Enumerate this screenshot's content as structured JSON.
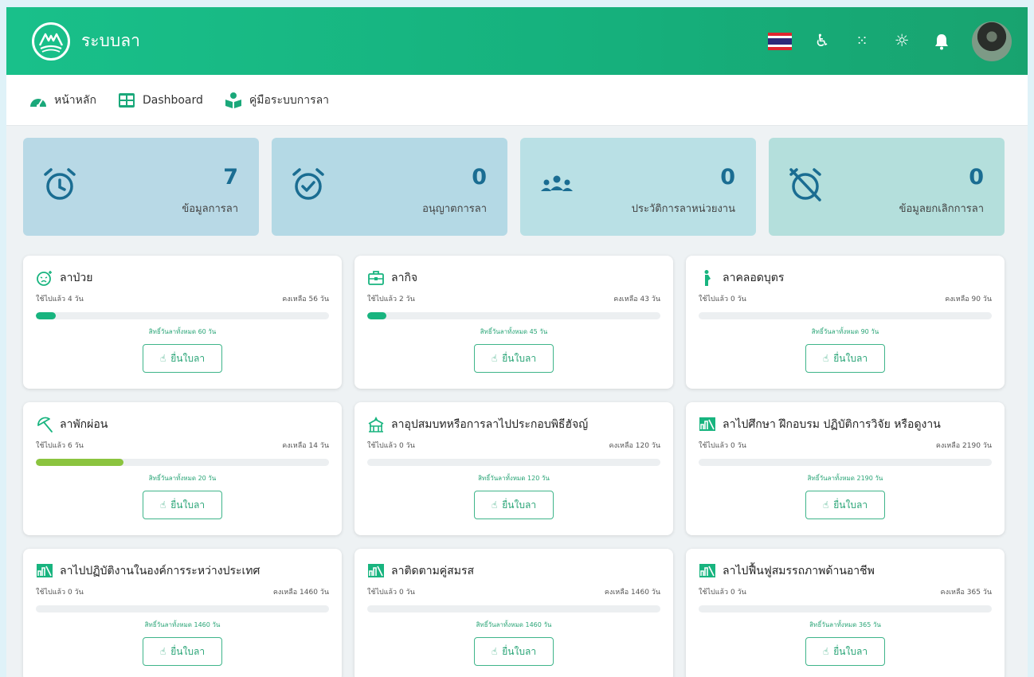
{
  "app": {
    "title": "ระบบลา"
  },
  "topbar": {
    "icons": [
      "thai-flag-icon",
      "accessibility-icon",
      "sign-language-icon",
      "theme-sun-icon",
      "bell-icon",
      "user-avatar"
    ],
    "brand_color": "#19c08a"
  },
  "nav": {
    "items": [
      {
        "label": "หน้าหลัก",
        "icon": "dashboard-gauge-icon"
      },
      {
        "label": "Dashboard",
        "icon": "grid-table-icon"
      },
      {
        "label": "คู่มือระบบการลา",
        "icon": "manual-book-icon"
      }
    ]
  },
  "stats": [
    {
      "value": "7",
      "label": "ข้อมูลการลา",
      "icon": "alarm-clock-icon",
      "color": "#b8d9e6"
    },
    {
      "value": "0",
      "label": "อนุญาตการลา",
      "icon": "alarm-check-icon",
      "color": "#b4d9e5"
    },
    {
      "value": "0",
      "label": "ประวัติการลาหน่วยงาน",
      "icon": "people-group-icon",
      "color": "#b9e0e5"
    },
    {
      "value": "0",
      "label": "ข้อมูลยกเลิกการลา",
      "icon": "alarm-off-icon",
      "color": "#b4dfdc"
    }
  ],
  "leave_types": [
    {
      "title": "ลาป่วย",
      "icon": "sick-face-icon",
      "used": "ใช้ไปแล้ว 4 วัน",
      "remaining": "คงเหลือ 56 วัน",
      "total": "สิทธิ์วันลาทั้งหมด 60 วัน",
      "progress": 0.067,
      "bar_color": "#18b47f",
      "button": "ยื่นใบลา"
    },
    {
      "title": "ลากิจ",
      "icon": "briefcase-icon",
      "used": "ใช้ไปแล้ว 2 วัน",
      "remaining": "คงเหลือ 43 วัน",
      "total": "สิทธิ์วันลาทั้งหมด 45 วัน",
      "progress": 0.044,
      "bar_color": "#18b47f",
      "button": "ยื่นใบลา"
    },
    {
      "title": "ลาคลอดบุตร",
      "icon": "pregnant-woman-icon",
      "used": "ใช้ไปแล้ว 0 วัน",
      "remaining": "คงเหลือ 90 วัน",
      "total": "สิทธิ์วันลาทั้งหมด 90 วัน",
      "progress": 0,
      "bar_color": "#18b47f",
      "button": "ยื่นใบลา"
    },
    {
      "title": "ลาพักผ่อน",
      "icon": "beach-umbrella-icon",
      "used": "ใช้ไปแล้ว 6 วัน",
      "remaining": "คงเหลือ 14 วัน",
      "total": "สิทธิ์วันลาทั้งหมด 20 วัน",
      "progress": 0.3,
      "bar_color": "#8bc43f",
      "button": "ยื่นใบลา"
    },
    {
      "title": "ลาอุปสมบทหรือการลาไปประกอบพิธีฮัจญ์",
      "icon": "temple-icon",
      "used": "ใช้ไปแล้ว 0 วัน",
      "remaining": "คงเหลือ 120 วัน",
      "total": "สิทธิ์วันลาทั้งหมด 120 วัน",
      "progress": 0,
      "bar_color": "#18b47f",
      "button": "ยื่นใบลา"
    },
    {
      "title": "ลาไปศึกษา ฝึกอบรม ปฏิบัติการวิจัย หรือดูงาน",
      "icon": "study-board-icon",
      "used": "ใช้ไปแล้ว 0 วัน",
      "remaining": "คงเหลือ 2190 วัน",
      "total": "สิทธิ์วันลาทั้งหมด 2190 วัน",
      "progress": 0,
      "bar_color": "#18b47f",
      "button": "ยื่นใบลา"
    },
    {
      "title": "ลาไปปฏิบัติงานในองค์การระหว่างประเทศ",
      "icon": "study-board-icon",
      "used": "ใช้ไปแล้ว 0 วัน",
      "remaining": "คงเหลือ 1460 วัน",
      "total": "สิทธิ์วันลาทั้งหมด 1460 วัน",
      "progress": 0,
      "bar_color": "#18b47f",
      "button": "ยื่นใบลา"
    },
    {
      "title": "ลาติดตามคู่สมรส",
      "icon": "study-board-icon",
      "used": "ใช้ไปแล้ว 0 วัน",
      "remaining": "คงเหลือ 1460 วัน",
      "total": "สิทธิ์วันลาทั้งหมด 1460 วัน",
      "progress": 0,
      "bar_color": "#18b47f",
      "button": "ยื่นใบลา"
    },
    {
      "title": "ลาไปฟื้นฟูสมรรถภาพด้านอาชีพ",
      "icon": "study-board-icon",
      "used": "ใช้ไปแล้ว 0 วัน",
      "remaining": "คงเหลือ 365 วัน",
      "total": "สิทธิ์วันลาทั้งหมด 365 วัน",
      "progress": 0,
      "bar_color": "#18b47f",
      "button": "ยื่นใบลา"
    }
  ]
}
